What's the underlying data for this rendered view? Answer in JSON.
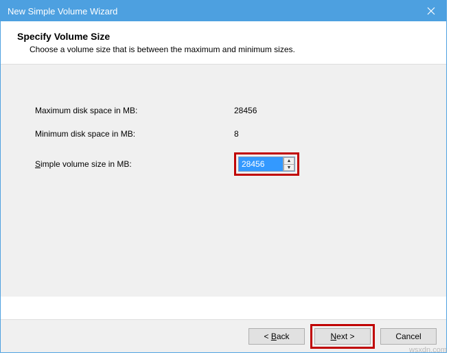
{
  "window": {
    "title": "New Simple Volume Wizard"
  },
  "header": {
    "heading": "Specify Volume Size",
    "subheading": "Choose a volume size that is between the maximum and minimum sizes."
  },
  "fields": {
    "max_label": "Maximum disk space in MB:",
    "max_value": "28456",
    "min_label": "Minimum disk space in MB:",
    "min_value": "8",
    "size_label_pre": "S",
    "size_label_post": "imple volume size in MB:",
    "size_value": "28456"
  },
  "buttons": {
    "back_pre": "< ",
    "back_u": "B",
    "back_post": "ack",
    "next_u": "N",
    "next_post": "ext >",
    "cancel": "Cancel"
  },
  "watermark": "wsxdn.com"
}
